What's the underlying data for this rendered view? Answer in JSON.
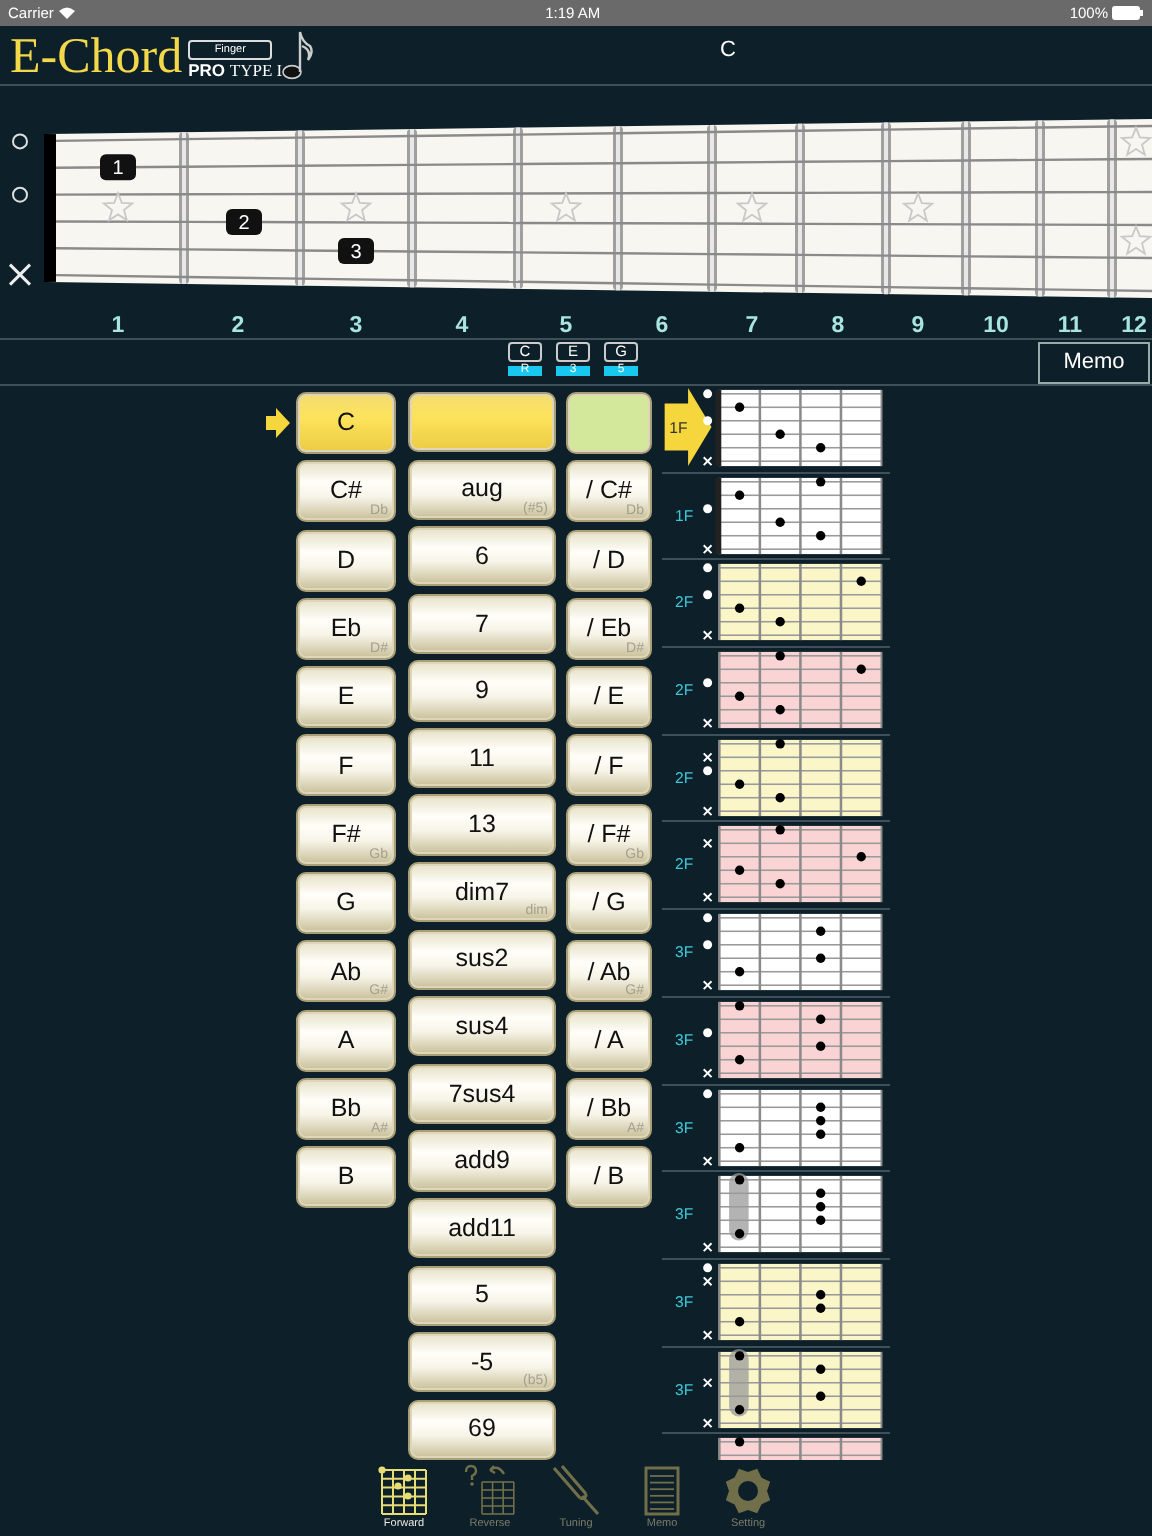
{
  "status_bar": {
    "carrier": "Carrier",
    "time": "1:19 AM",
    "battery": "100%"
  },
  "header": {
    "logo": "E-Chord",
    "mode_button": "Finger",
    "edition_bold": "PRO",
    "edition": "TYPE I",
    "chord_name": "C"
  },
  "fretboard": {
    "strings": [
      {
        "kind": "open"
      },
      {
        "kind": "fretted",
        "finger": "1",
        "pressed": [
          true,
          false,
          false,
          false,
          false,
          false,
          false,
          false,
          false,
          false,
          false,
          false
        ]
      },
      {
        "kind": "open"
      },
      {
        "kind": "fretted",
        "finger": "2",
        "pressed": [
          false,
          true,
          false,
          false,
          false,
          false,
          false,
          false,
          false,
          false,
          false,
          false
        ]
      },
      {
        "kind": "fretted",
        "finger": "3",
        "pressed": [
          false,
          false,
          true,
          false,
          false,
          false,
          false,
          false,
          false,
          false,
          false,
          false
        ]
      },
      {
        "kind": "mute"
      }
    ],
    "fret_numbers": [
      "1",
      "2",
      "3",
      "4",
      "5",
      "6",
      "7",
      "8",
      "9",
      "10",
      "11",
      "12"
    ]
  },
  "notes": [
    {
      "note": "C",
      "degree": "R"
    },
    {
      "note": "E",
      "degree": "3"
    },
    {
      "note": "G",
      "degree": "5"
    }
  ],
  "memo_button": "Memo",
  "roots": [
    {
      "label": "C",
      "selected": true
    },
    {
      "label": "C#",
      "alt": "Db",
      "selected": false
    },
    {
      "label": "D",
      "selected": false
    },
    {
      "label": "Eb",
      "alt": "D#",
      "selected": false
    },
    {
      "label": "E",
      "selected": false
    },
    {
      "label": "F",
      "selected": false
    },
    {
      "label": "F#",
      "alt": "Gb",
      "selected": false
    },
    {
      "label": "G",
      "selected": false
    },
    {
      "label": "Ab",
      "alt": "G#",
      "selected": false
    },
    {
      "label": "A",
      "selected": false
    },
    {
      "label": "Bb",
      "alt": "A#",
      "selected": false
    },
    {
      "label": "B",
      "selected": false
    }
  ],
  "qualities": [
    {
      "selected": true
    },
    {
      "label": "aug",
      "alt": "(#5)",
      "selected": false
    },
    {
      "label": "6",
      "selected": false
    },
    {
      "label": "7",
      "selected": false
    },
    {
      "label": "9",
      "selected": false
    },
    {
      "label": "11",
      "selected": false
    },
    {
      "label": "13",
      "selected": false
    },
    {
      "label": "dim7",
      "alt": "dim",
      "selected": false
    },
    {
      "label": "sus2",
      "selected": false
    },
    {
      "label": "sus4",
      "selected": false
    },
    {
      "label": "7sus4",
      "selected": false
    },
    {
      "label": "add9",
      "selected": false
    },
    {
      "label": "add11",
      "selected": false
    },
    {
      "label": "5",
      "selected": false
    },
    {
      "label": "-5",
      "alt": "(b5)",
      "selected": false
    },
    {
      "label": "69",
      "selected": false
    }
  ],
  "bass": [
    {
      "selected": true
    },
    {
      "label": "/ C#",
      "alt": "Db",
      "selected": false
    },
    {
      "label": "/ D",
      "selected": false
    },
    {
      "label": "/ Eb",
      "alt": "D#",
      "selected": false
    },
    {
      "label": "/ E",
      "selected": false
    },
    {
      "label": "/ F",
      "selected": false
    },
    {
      "label": "/ F#",
      "alt": "Gb",
      "selected": false
    },
    {
      "label": "/ G",
      "selected": false
    },
    {
      "label": "/ Ab",
      "alt": "G#",
      "selected": false
    },
    {
      "label": "/ A",
      "selected": false
    },
    {
      "label": "/ Bb",
      "alt": "A#",
      "selected": false
    },
    {
      "label": "/ B",
      "selected": false
    }
  ],
  "diagrams": [
    {
      "position": "1F",
      "selected": true,
      "nut": true,
      "barre": false,
      "color": "#ffffff",
      "strings": [
        {
          "kind": "open"
        },
        {
          "kind": "fretted",
          "pressed": [
            true,
            false,
            false,
            false
          ]
        },
        {
          "kind": "open"
        },
        {
          "kind": "fretted",
          "pressed": [
            false,
            true,
            false,
            false
          ]
        },
        {
          "kind": "fretted",
          "pressed": [
            false,
            false,
            true,
            false
          ]
        },
        {
          "kind": "mute"
        }
      ]
    },
    {
      "position": "1F",
      "selected": false,
      "nut": true,
      "barre": false,
      "color": "#ffffff",
      "strings": [
        {
          "kind": "fretted",
          "pressed": [
            false,
            false,
            true,
            false
          ]
        },
        {
          "kind": "fretted",
          "pressed": [
            true,
            false,
            false,
            false
          ]
        },
        {
          "kind": "open"
        },
        {
          "kind": "fretted",
          "pressed": [
            false,
            true,
            false,
            false
          ]
        },
        {
          "kind": "fretted",
          "pressed": [
            false,
            false,
            true,
            false
          ]
        },
        {
          "kind": "mute"
        }
      ]
    },
    {
      "position": "2F",
      "selected": false,
      "nut": false,
      "barre": false,
      "color": "#faf6c8",
      "strings": [
        {
          "kind": "open"
        },
        {
          "kind": "fretted",
          "pressed": [
            false,
            false,
            false,
            true
          ]
        },
        {
          "kind": "open"
        },
        {
          "kind": "fretted",
          "pressed": [
            true,
            false,
            false,
            false
          ]
        },
        {
          "kind": "fretted",
          "pressed": [
            false,
            true,
            false,
            false
          ]
        },
        {
          "kind": "mute"
        }
      ]
    },
    {
      "position": "2F",
      "selected": false,
      "nut": false,
      "barre": false,
      "color": "#fad4d4",
      "strings": [
        {
          "kind": "fretted",
          "pressed": [
            false,
            true,
            false,
            false
          ]
        },
        {
          "kind": "fretted",
          "pressed": [
            false,
            false,
            false,
            true
          ]
        },
        {
          "kind": "open"
        },
        {
          "kind": "fretted",
          "pressed": [
            true,
            false,
            false,
            false
          ]
        },
        {
          "kind": "fretted",
          "pressed": [
            false,
            true,
            false,
            false
          ]
        },
        {
          "kind": "mute"
        }
      ]
    },
    {
      "position": "2F",
      "selected": false,
      "nut": false,
      "barre": false,
      "color": "#faf6c8",
      "strings": [
        {
          "kind": "fretted",
          "pressed": [
            false,
            true,
            false,
            false
          ]
        },
        {
          "kind": "mute"
        },
        {
          "kind": "open"
        },
        {
          "kind": "fretted",
          "pressed": [
            true,
            false,
            false,
            false
          ]
        },
        {
          "kind": "fretted",
          "pressed": [
            false,
            true,
            false,
            false
          ]
        },
        {
          "kind": "mute"
        }
      ]
    },
    {
      "position": "2F",
      "selected": false,
      "nut": false,
      "barre": false,
      "color": "#fad4d4",
      "strings": [
        {
          "kind": "fretted",
          "pressed": [
            false,
            true,
            false,
            false
          ]
        },
        {
          "kind": "mute"
        },
        {
          "kind": "fretted",
          "pressed": [
            false,
            false,
            false,
            true
          ]
        },
        {
          "kind": "fretted",
          "pressed": [
            true,
            false,
            false,
            false
          ]
        },
        {
          "kind": "fretted",
          "pressed": [
            false,
            true,
            false,
            false
          ]
        },
        {
          "kind": "mute"
        }
      ]
    },
    {
      "position": "3F",
      "selected": false,
      "nut": false,
      "barre": false,
      "color": "#ffffff",
      "strings": [
        {
          "kind": "open"
        },
        {
          "kind": "fretted",
          "pressed": [
            false,
            false,
            true,
            false
          ]
        },
        {
          "kind": "open"
        },
        {
          "kind": "fretted",
          "pressed": [
            false,
            false,
            true,
            false
          ]
        },
        {
          "kind": "fretted",
          "pressed": [
            true,
            false,
            false,
            false
          ]
        },
        {
          "kind": "mute"
        }
      ]
    },
    {
      "position": "3F",
      "selected": false,
      "nut": false,
      "barre": false,
      "color": "#fad4d4",
      "strings": [
        {
          "kind": "fretted",
          "pressed": [
            true,
            false,
            false,
            false
          ]
        },
        {
          "kind": "fretted",
          "pressed": [
            false,
            false,
            true,
            false
          ]
        },
        {
          "kind": "open"
        },
        {
          "kind": "fretted",
          "pressed": [
            false,
            false,
            true,
            false
          ]
        },
        {
          "kind": "fretted",
          "pressed": [
            true,
            false,
            false,
            false
          ]
        },
        {
          "kind": "mute"
        }
      ]
    },
    {
      "position": "3F",
      "selected": false,
      "nut": false,
      "barre": false,
      "color": "#ffffff",
      "strings": [
        {
          "kind": "open"
        },
        {
          "kind": "fretted",
          "pressed": [
            false,
            false,
            true,
            false
          ]
        },
        {
          "kind": "fretted",
          "pressed": [
            false,
            false,
            true,
            false
          ]
        },
        {
          "kind": "fretted",
          "pressed": [
            false,
            false,
            true,
            false
          ]
        },
        {
          "kind": "fretted",
          "pressed": [
            true,
            false,
            false,
            false
          ]
        },
        {
          "kind": "mute"
        }
      ]
    },
    {
      "position": "3F",
      "selected": false,
      "nut": false,
      "barre": true,
      "color": "#ffffff",
      "strings": [
        {
          "kind": "fretted",
          "pressed": [
            true,
            false,
            false,
            false
          ]
        },
        {
          "kind": "fretted",
          "pressed": [
            false,
            false,
            true,
            false
          ]
        },
        {
          "kind": "fretted",
          "pressed": [
            false,
            false,
            true,
            false
          ]
        },
        {
          "kind": "fretted",
          "pressed": [
            false,
            false,
            true,
            false
          ]
        },
        {
          "kind": "fretted",
          "pressed": [
            true,
            false,
            false,
            false
          ]
        },
        {
          "kind": "mute"
        }
      ]
    },
    {
      "position": "3F",
      "selected": false,
      "nut": false,
      "barre": false,
      "color": "#faf6c8",
      "strings": [
        {
          "kind": "open"
        },
        {
          "kind": "mute"
        },
        {
          "kind": "fretted",
          "pressed": [
            false,
            false,
            true,
            false
          ]
        },
        {
          "kind": "fretted",
          "pressed": [
            false,
            false,
            true,
            false
          ]
        },
        {
          "kind": "fretted",
          "pressed": [
            true,
            false,
            false,
            false
          ]
        },
        {
          "kind": "mute"
        }
      ]
    },
    {
      "position": "3F",
      "selected": false,
      "nut": false,
      "barre": true,
      "color": "#faf6c8",
      "strings": [
        {
          "kind": "fretted",
          "pressed": [
            true,
            false,
            false,
            false
          ]
        },
        {
          "kind": "fretted",
          "pressed": [
            false,
            false,
            true,
            false
          ]
        },
        {
          "kind": "mute"
        },
        {
          "kind": "fretted",
          "pressed": [
            false,
            false,
            true,
            false
          ]
        },
        {
          "kind": "fretted",
          "pressed": [
            true,
            false,
            false,
            false
          ]
        },
        {
          "kind": "mute"
        }
      ]
    },
    {
      "color": "#fad4d4",
      "strings": [
        {
          "kind": "fretted",
          "pressed": [
            true,
            false,
            false,
            false
          ]
        }
      ]
    }
  ],
  "tabs": [
    {
      "label": "Forward",
      "kind": "forward",
      "selected": true
    },
    {
      "label": "Reverse",
      "kind": "reverse",
      "selected": false
    },
    {
      "label": "Tuning",
      "kind": "tuning",
      "selected": false
    },
    {
      "label": "Memo",
      "kind": "memo",
      "selected": false
    },
    {
      "label": "Setting",
      "kind": "setting",
      "selected": false
    }
  ]
}
